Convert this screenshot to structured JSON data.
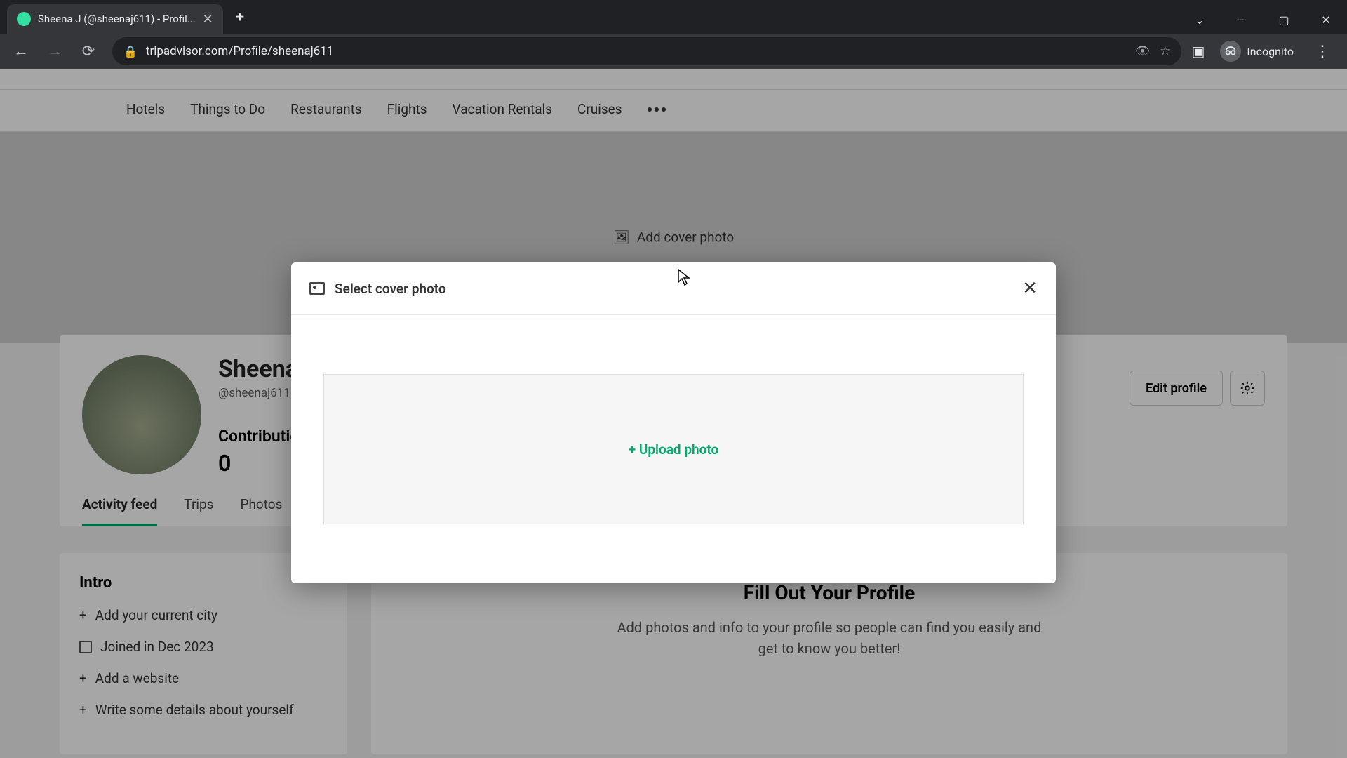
{
  "browser": {
    "tab_title": "Sheena J (@sheenaj611) - Profil...",
    "url": "tripadvisor.com/Profile/sheenaj611",
    "incognito_label": "Incognito"
  },
  "nav": {
    "items": [
      "Hotels",
      "Things to Do",
      "Restaurants",
      "Flights",
      "Vacation Rentals",
      "Cruises"
    ]
  },
  "cover": {
    "add_label": "Add cover photo"
  },
  "profile": {
    "name": "Sheena J",
    "handle": "@sheenaj611",
    "contrib_label": "Contributions",
    "contrib_value": "0",
    "edit_label": "Edit profile",
    "tabs": [
      "Activity feed",
      "Trips",
      "Photos"
    ]
  },
  "intro": {
    "title": "Intro",
    "items": {
      "city": "Add your current city",
      "joined": "Joined in Dec 2023",
      "website": "Add a website",
      "about": "Write some details about yourself"
    }
  },
  "fillout": {
    "title": "Fill Out Your Profile",
    "body": "Add photos and info to your profile so people can find you easily and get to know you better!"
  },
  "modal": {
    "title": "Select cover photo",
    "upload_label": "+ Upload photo"
  }
}
